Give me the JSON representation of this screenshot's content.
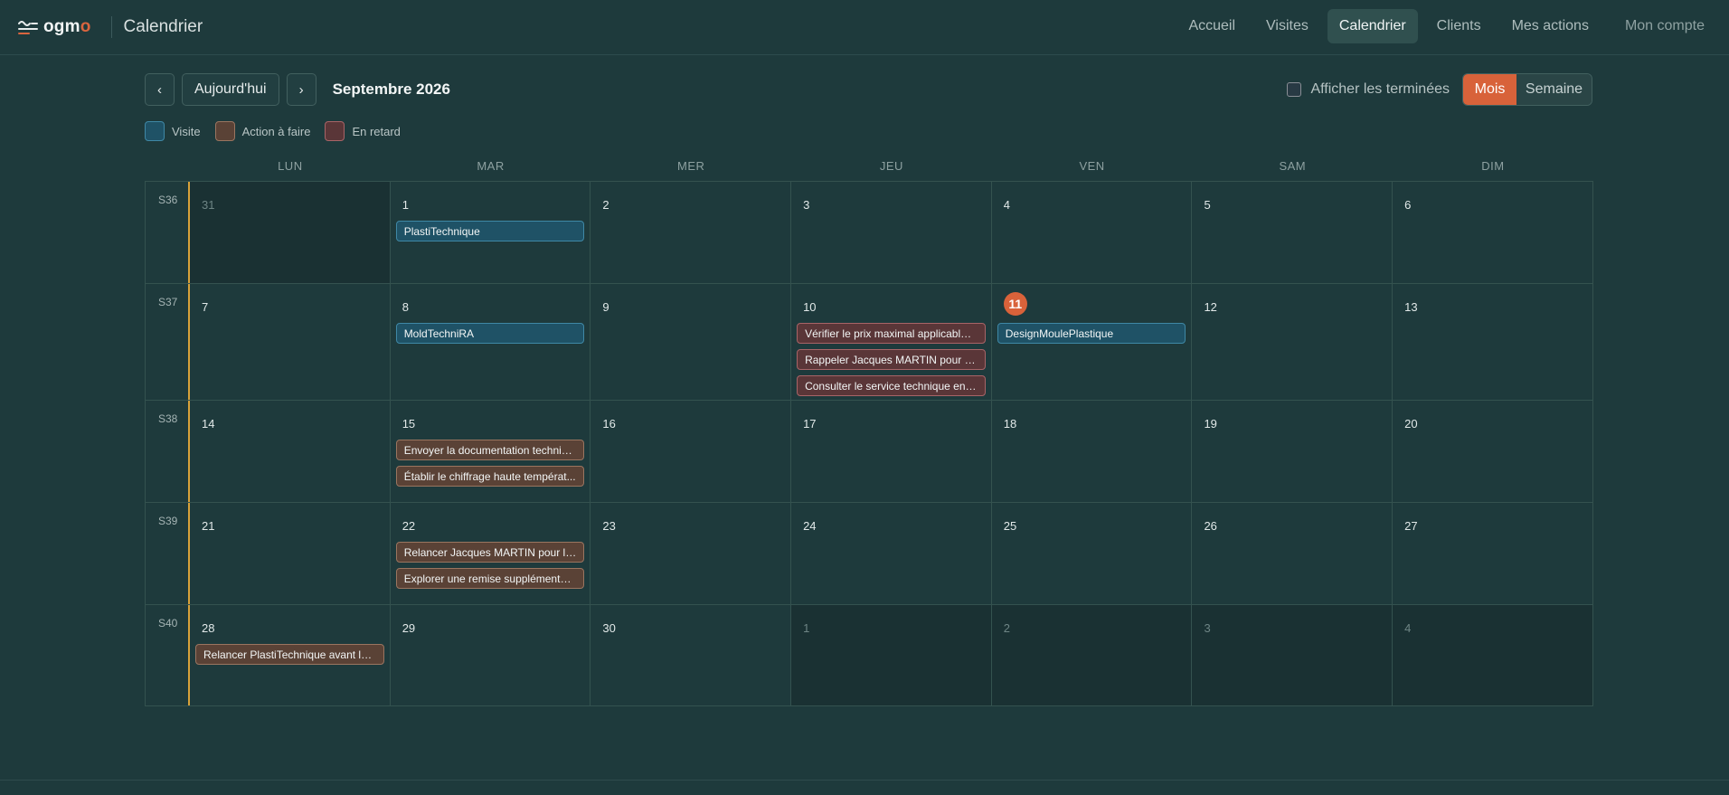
{
  "app": {
    "brand_prefix": "ogm",
    "brand_accent": "o",
    "page_title": "Calendrier"
  },
  "nav": [
    {
      "label": "Accueil",
      "active": false
    },
    {
      "label": "Visites",
      "active": false
    },
    {
      "label": "Calendrier",
      "active": true
    },
    {
      "label": "Clients",
      "active": false
    },
    {
      "label": "Mes actions",
      "active": false
    }
  ],
  "account_label": "Mon compte",
  "toolbar": {
    "prev": "‹",
    "today": "Aujourd'hui",
    "next": "›",
    "month_title": "Septembre 2026"
  },
  "show_done_label": "Afficher les terminées",
  "view": {
    "month": "Mois",
    "week": "Semaine"
  },
  "legend": [
    {
      "label": "Visite",
      "color": "#1f5266",
      "border": "#3f88a6"
    },
    {
      "label": "Action à faire",
      "color": "#5a4236",
      "border": "#9a7560"
    },
    {
      "label": "En retard",
      "color": "#5a3638",
      "border": "#a86467"
    }
  ],
  "weekdays": [
    "LUN",
    "MAR",
    "MER",
    "JEU",
    "VEN",
    "SAM",
    "DIM"
  ],
  "weeks": [
    {
      "label": "S36",
      "days": [
        {
          "num": "31",
          "other": true,
          "events": []
        },
        {
          "num": "1",
          "events": [
            {
              "type": "visite",
              "text": "PlastiTechnique"
            }
          ]
        },
        {
          "num": "2",
          "events": []
        },
        {
          "num": "3",
          "events": []
        },
        {
          "num": "4",
          "events": []
        },
        {
          "num": "5",
          "events": []
        },
        {
          "num": "6",
          "events": []
        }
      ]
    },
    {
      "label": "S37",
      "days": [
        {
          "num": "7",
          "events": []
        },
        {
          "num": "8",
          "events": [
            {
              "type": "visite",
              "text": "MoldTechniRA"
            }
          ]
        },
        {
          "num": "9",
          "events": []
        },
        {
          "num": "10",
          "events": [
            {
              "type": "late",
              "text": "Vérifier le prix maximal applicable ..."
            },
            {
              "type": "late",
              "text": "Rappeler Jacques MARTIN pour va..."
            },
            {
              "type": "late",
              "text": "Consulter le service technique en i..."
            }
          ]
        },
        {
          "num": "11",
          "today": true,
          "events": [
            {
              "type": "visite",
              "text": "DesignMoulePlastique"
            }
          ]
        },
        {
          "num": "12",
          "events": []
        },
        {
          "num": "13",
          "events": []
        }
      ]
    },
    {
      "label": "S38",
      "days": [
        {
          "num": "14",
          "events": []
        },
        {
          "num": "15",
          "events": [
            {
              "type": "action",
              "text": "Envoyer la documentation techniq..."
            },
            {
              "type": "action",
              "text": "Établir le chiffrage haute températ..."
            }
          ]
        },
        {
          "num": "16",
          "events": []
        },
        {
          "num": "17",
          "events": []
        },
        {
          "num": "18",
          "events": []
        },
        {
          "num": "19",
          "events": []
        },
        {
          "num": "20",
          "events": []
        }
      ]
    },
    {
      "label": "S39",
      "days": [
        {
          "num": "21",
          "events": []
        },
        {
          "num": "22",
          "events": [
            {
              "type": "action",
              "text": "Relancer Jacques MARTIN pour la ..."
            },
            {
              "type": "action",
              "text": "Explorer une remise supplémentai..."
            }
          ]
        },
        {
          "num": "23",
          "events": []
        },
        {
          "num": "24",
          "events": []
        },
        {
          "num": "25",
          "events": []
        },
        {
          "num": "26",
          "events": []
        },
        {
          "num": "27",
          "events": []
        }
      ]
    },
    {
      "label": "S40",
      "days": [
        {
          "num": "28",
          "events": [
            {
              "type": "action",
              "text": "Relancer PlastiTechnique avant la ..."
            }
          ]
        },
        {
          "num": "29",
          "events": []
        },
        {
          "num": "30",
          "events": []
        },
        {
          "num": "1",
          "other": true,
          "events": []
        },
        {
          "num": "2",
          "other": true,
          "events": []
        },
        {
          "num": "3",
          "other": true,
          "events": []
        },
        {
          "num": "4",
          "other": true,
          "events": []
        }
      ]
    }
  ]
}
